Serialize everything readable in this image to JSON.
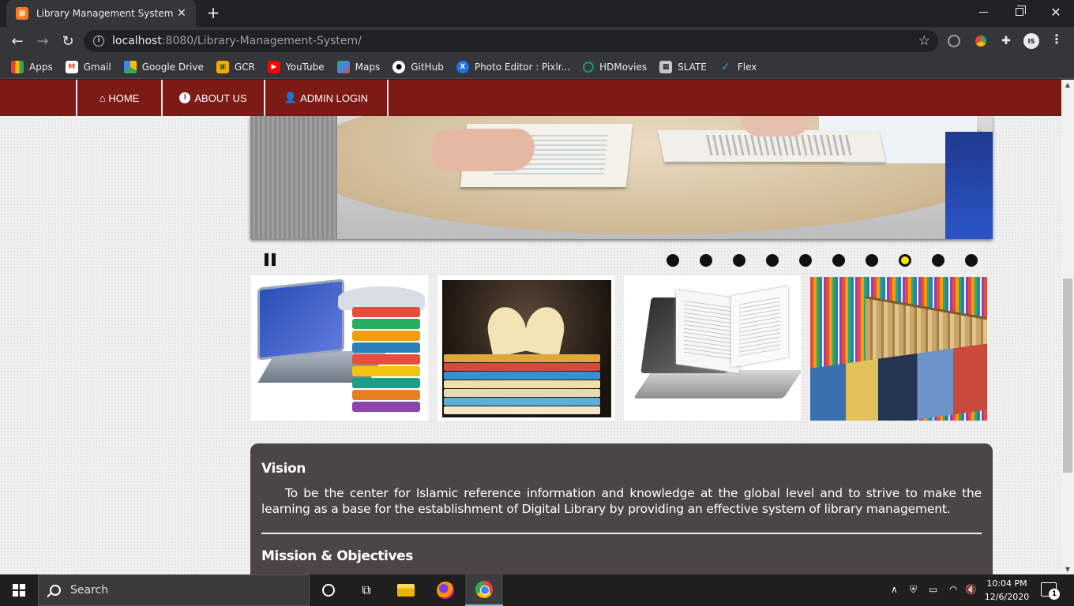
{
  "browser": {
    "tab_title": "Library Management System",
    "favicon_text": "⊠",
    "tab_close": "✕",
    "new_tab": "+",
    "url_host": "localhost",
    "url_rest": ":8080/Library-Management-System/",
    "bookmarks": [
      {
        "label": "Apps",
        "icon": "apps-grid-icon"
      },
      {
        "label": "Gmail",
        "icon": "gmail-icon"
      },
      {
        "label": "Google Drive",
        "icon": "google-drive-icon"
      },
      {
        "label": "GCR",
        "icon": "classroom-icon"
      },
      {
        "label": "YouTube",
        "icon": "youtube-icon"
      },
      {
        "label": "Maps",
        "icon": "maps-icon"
      },
      {
        "label": "GitHub",
        "icon": "github-icon"
      },
      {
        "label": "Photo Editor : Pixlr...",
        "icon": "pixlr-icon"
      },
      {
        "label": "HDMovies",
        "icon": "hdmovies-icon"
      },
      {
        "label": "SLATE",
        "icon": "slate-icon"
      },
      {
        "label": "Flex",
        "icon": "flex-icon"
      }
    ]
  },
  "navbar": {
    "items": [
      {
        "label": "HOME",
        "icon": "home-icon"
      },
      {
        "label": "ABOUT US",
        "icon": "info-circle-icon"
      },
      {
        "label": "ADMIN LOGIN",
        "icon": "user-icon"
      }
    ]
  },
  "slider": {
    "slide_count": 10,
    "active_slide_index": 7
  },
  "content": {
    "vision_title": "Vision",
    "vision_text": "To be the center for Islamic reference information and knowledge at the global level and to strive to make the learning as a base for the establishment of Digital Library by providing an effective system of library management.",
    "mission_title": "Mission & Objectives"
  },
  "taskbar": {
    "search_placeholder": "Search",
    "time": "10:04 PM",
    "date": "12/6/2020",
    "notification_count": "1"
  },
  "colors": {
    "navbar_bg": "#7c1a16",
    "panel_bg": "#4b4544",
    "active_dot": "#f5e400"
  }
}
